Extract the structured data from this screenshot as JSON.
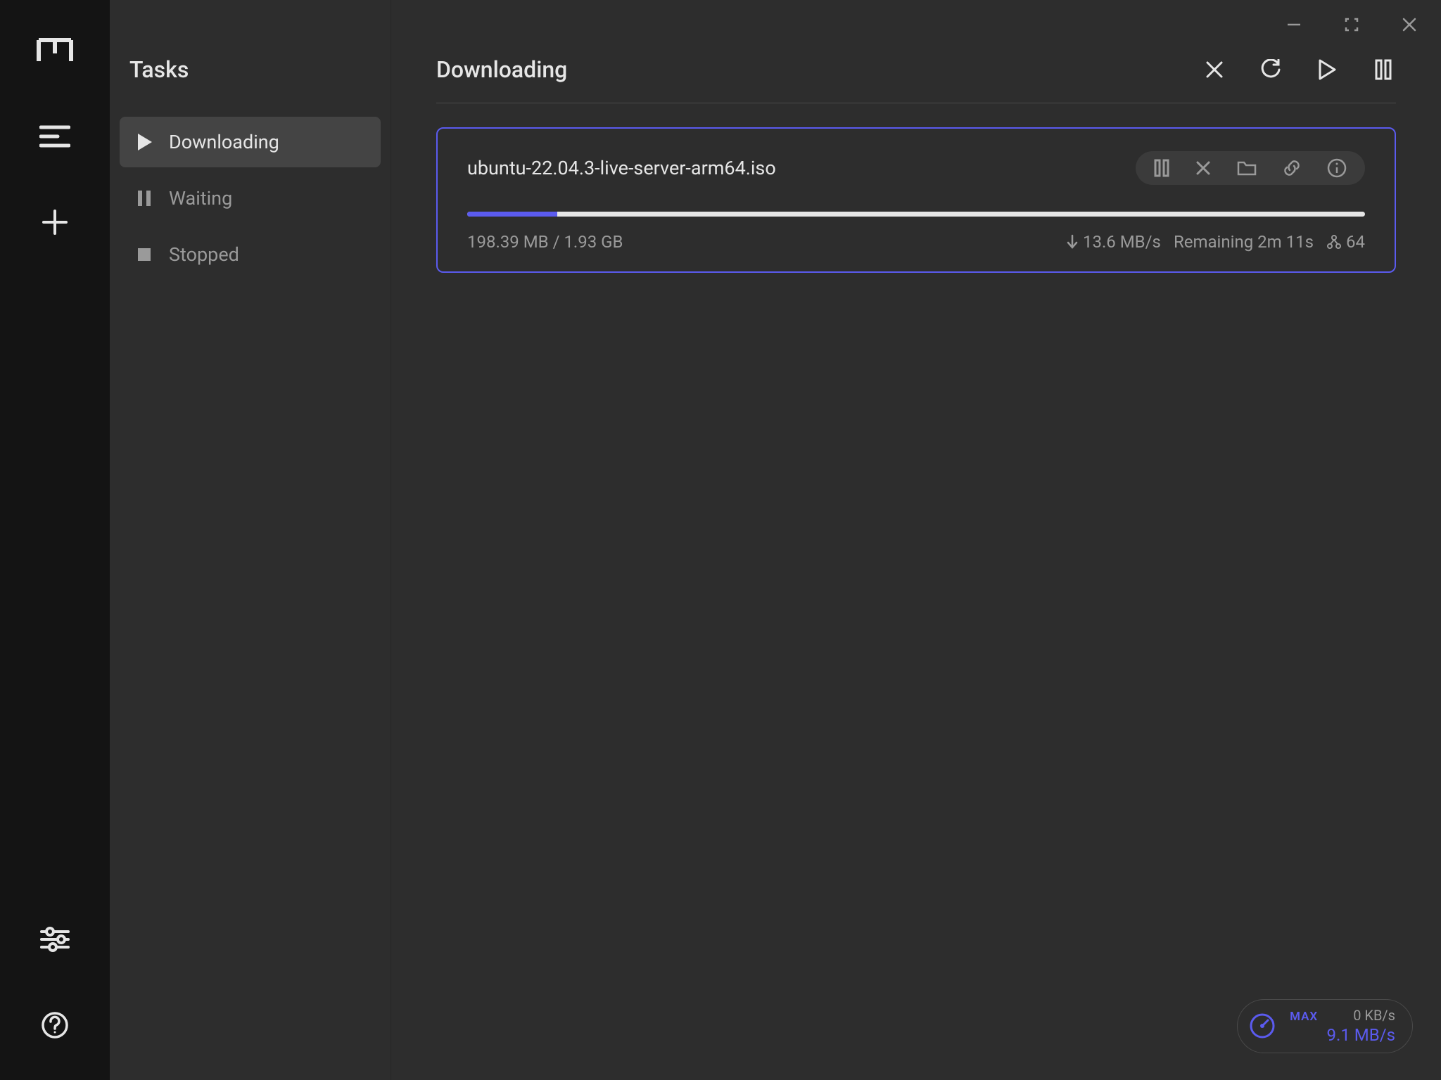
{
  "sidebar": {
    "title": "Tasks",
    "items": [
      {
        "label": "Downloading",
        "icon": "play-icon",
        "active": true
      },
      {
        "label": "Waiting",
        "icon": "pause-icon",
        "active": false
      },
      {
        "label": "Stopped",
        "icon": "stop-icon",
        "active": false
      }
    ]
  },
  "main": {
    "title": "Downloading"
  },
  "task": {
    "filename": "ubuntu-22.04.3-live-server-arm64.iso",
    "progress_percent": 10,
    "size_text": "198.39 MB / 1.93 GB",
    "speed_text": "13.6 MB/s",
    "remaining_text": "Remaining 2m 11s",
    "connections_text": "64"
  },
  "speed_badge": {
    "mode": "MAX",
    "upload": "0 KB/s",
    "download": "9.1 MB/s"
  }
}
